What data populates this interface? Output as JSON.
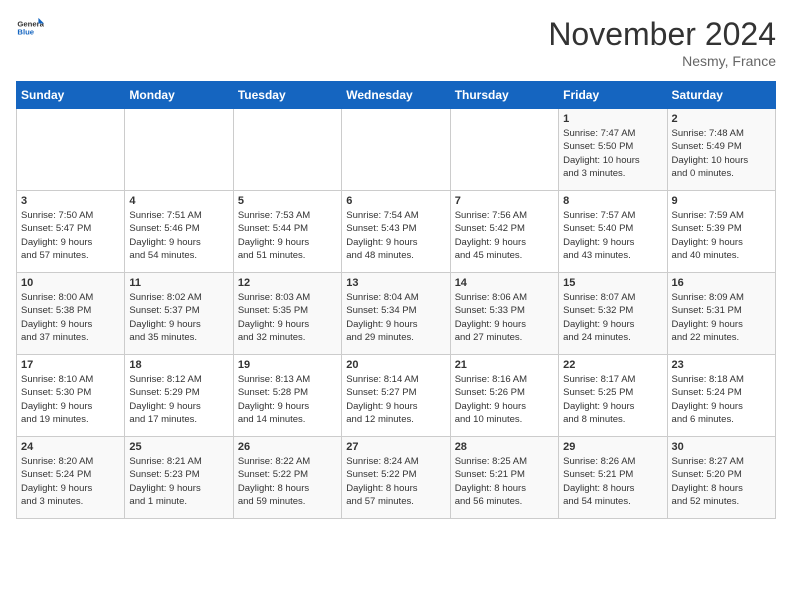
{
  "header": {
    "logo_general": "General",
    "logo_blue": "Blue",
    "month_title": "November 2024",
    "location": "Nesmy, France"
  },
  "days_of_week": [
    "Sunday",
    "Monday",
    "Tuesday",
    "Wednesday",
    "Thursday",
    "Friday",
    "Saturday"
  ],
  "weeks": [
    [
      {
        "day": "",
        "info": ""
      },
      {
        "day": "",
        "info": ""
      },
      {
        "day": "",
        "info": ""
      },
      {
        "day": "",
        "info": ""
      },
      {
        "day": "",
        "info": ""
      },
      {
        "day": "1",
        "info": "Sunrise: 7:47 AM\nSunset: 5:50 PM\nDaylight: 10 hours\nand 3 minutes."
      },
      {
        "day": "2",
        "info": "Sunrise: 7:48 AM\nSunset: 5:49 PM\nDaylight: 10 hours\nand 0 minutes."
      }
    ],
    [
      {
        "day": "3",
        "info": "Sunrise: 7:50 AM\nSunset: 5:47 PM\nDaylight: 9 hours\nand 57 minutes."
      },
      {
        "day": "4",
        "info": "Sunrise: 7:51 AM\nSunset: 5:46 PM\nDaylight: 9 hours\nand 54 minutes."
      },
      {
        "day": "5",
        "info": "Sunrise: 7:53 AM\nSunset: 5:44 PM\nDaylight: 9 hours\nand 51 minutes."
      },
      {
        "day": "6",
        "info": "Sunrise: 7:54 AM\nSunset: 5:43 PM\nDaylight: 9 hours\nand 48 minutes."
      },
      {
        "day": "7",
        "info": "Sunrise: 7:56 AM\nSunset: 5:42 PM\nDaylight: 9 hours\nand 45 minutes."
      },
      {
        "day": "8",
        "info": "Sunrise: 7:57 AM\nSunset: 5:40 PM\nDaylight: 9 hours\nand 43 minutes."
      },
      {
        "day": "9",
        "info": "Sunrise: 7:59 AM\nSunset: 5:39 PM\nDaylight: 9 hours\nand 40 minutes."
      }
    ],
    [
      {
        "day": "10",
        "info": "Sunrise: 8:00 AM\nSunset: 5:38 PM\nDaylight: 9 hours\nand 37 minutes."
      },
      {
        "day": "11",
        "info": "Sunrise: 8:02 AM\nSunset: 5:37 PM\nDaylight: 9 hours\nand 35 minutes."
      },
      {
        "day": "12",
        "info": "Sunrise: 8:03 AM\nSunset: 5:35 PM\nDaylight: 9 hours\nand 32 minutes."
      },
      {
        "day": "13",
        "info": "Sunrise: 8:04 AM\nSunset: 5:34 PM\nDaylight: 9 hours\nand 29 minutes."
      },
      {
        "day": "14",
        "info": "Sunrise: 8:06 AM\nSunset: 5:33 PM\nDaylight: 9 hours\nand 27 minutes."
      },
      {
        "day": "15",
        "info": "Sunrise: 8:07 AM\nSunset: 5:32 PM\nDaylight: 9 hours\nand 24 minutes."
      },
      {
        "day": "16",
        "info": "Sunrise: 8:09 AM\nSunset: 5:31 PM\nDaylight: 9 hours\nand 22 minutes."
      }
    ],
    [
      {
        "day": "17",
        "info": "Sunrise: 8:10 AM\nSunset: 5:30 PM\nDaylight: 9 hours\nand 19 minutes."
      },
      {
        "day": "18",
        "info": "Sunrise: 8:12 AM\nSunset: 5:29 PM\nDaylight: 9 hours\nand 17 minutes."
      },
      {
        "day": "19",
        "info": "Sunrise: 8:13 AM\nSunset: 5:28 PM\nDaylight: 9 hours\nand 14 minutes."
      },
      {
        "day": "20",
        "info": "Sunrise: 8:14 AM\nSunset: 5:27 PM\nDaylight: 9 hours\nand 12 minutes."
      },
      {
        "day": "21",
        "info": "Sunrise: 8:16 AM\nSunset: 5:26 PM\nDaylight: 9 hours\nand 10 minutes."
      },
      {
        "day": "22",
        "info": "Sunrise: 8:17 AM\nSunset: 5:25 PM\nDaylight: 9 hours\nand 8 minutes."
      },
      {
        "day": "23",
        "info": "Sunrise: 8:18 AM\nSunset: 5:24 PM\nDaylight: 9 hours\nand 6 minutes."
      }
    ],
    [
      {
        "day": "24",
        "info": "Sunrise: 8:20 AM\nSunset: 5:24 PM\nDaylight: 9 hours\nand 3 minutes."
      },
      {
        "day": "25",
        "info": "Sunrise: 8:21 AM\nSunset: 5:23 PM\nDaylight: 9 hours\nand 1 minute."
      },
      {
        "day": "26",
        "info": "Sunrise: 8:22 AM\nSunset: 5:22 PM\nDaylight: 8 hours\nand 59 minutes."
      },
      {
        "day": "27",
        "info": "Sunrise: 8:24 AM\nSunset: 5:22 PM\nDaylight: 8 hours\nand 57 minutes."
      },
      {
        "day": "28",
        "info": "Sunrise: 8:25 AM\nSunset: 5:21 PM\nDaylight: 8 hours\nand 56 minutes."
      },
      {
        "day": "29",
        "info": "Sunrise: 8:26 AM\nSunset: 5:21 PM\nDaylight: 8 hours\nand 54 minutes."
      },
      {
        "day": "30",
        "info": "Sunrise: 8:27 AM\nSunset: 5:20 PM\nDaylight: 8 hours\nand 52 minutes."
      }
    ]
  ]
}
